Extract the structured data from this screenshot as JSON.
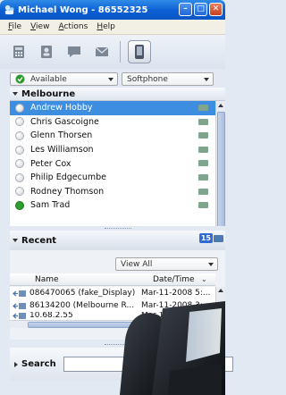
{
  "window": {
    "title": "Michael Wong - 86552325",
    "min": "–",
    "max": "□",
    "close": "✕"
  },
  "menu": [
    {
      "key": "F",
      "rest": "ile"
    },
    {
      "key": "V",
      "rest": "iew"
    },
    {
      "key": "A",
      "rest": "ctions"
    },
    {
      "key": "H",
      "rest": "elp"
    }
  ],
  "toolbar": {
    "icons": [
      "dialpad-icon",
      "contacts-icon",
      "chat-icon",
      "email-icon",
      "phone-view-icon"
    ]
  },
  "presence": {
    "value": "Available"
  },
  "device": {
    "value": "Softphone"
  },
  "group": {
    "name": "Melbourne"
  },
  "contacts": [
    {
      "name": "Andrew Hobby",
      "online": false,
      "selected": true
    },
    {
      "name": "Chris Gascoigne",
      "online": false,
      "selected": false
    },
    {
      "name": "Glenn Thorsen",
      "online": false,
      "selected": false
    },
    {
      "name": "Les Williamson",
      "online": false,
      "selected": false
    },
    {
      "name": "Peter Cox",
      "online": false,
      "selected": false
    },
    {
      "name": "Philip Edgecumbe",
      "online": false,
      "selected": false
    },
    {
      "name": "Rodney Thomson",
      "online": false,
      "selected": false
    },
    {
      "name": "Sam Trad",
      "online": true,
      "selected": false
    }
  ],
  "recent": {
    "title": "Recent",
    "count": "15",
    "filter": "View All",
    "columns": {
      "name": "Name",
      "datetime": "Date/Time"
    },
    "calls": [
      {
        "name": "086470065 (fake_Display)",
        "datetime": "Mar-11-2008 5:..."
      },
      {
        "name": "86134200 (Melbourne R...",
        "datetime": "Mar-11-2008 3:..."
      },
      {
        "name": "10.68.2.55",
        "datetime": "Mar-11-2008 3:..."
      }
    ]
  },
  "search": {
    "label": "Search",
    "value": ""
  }
}
